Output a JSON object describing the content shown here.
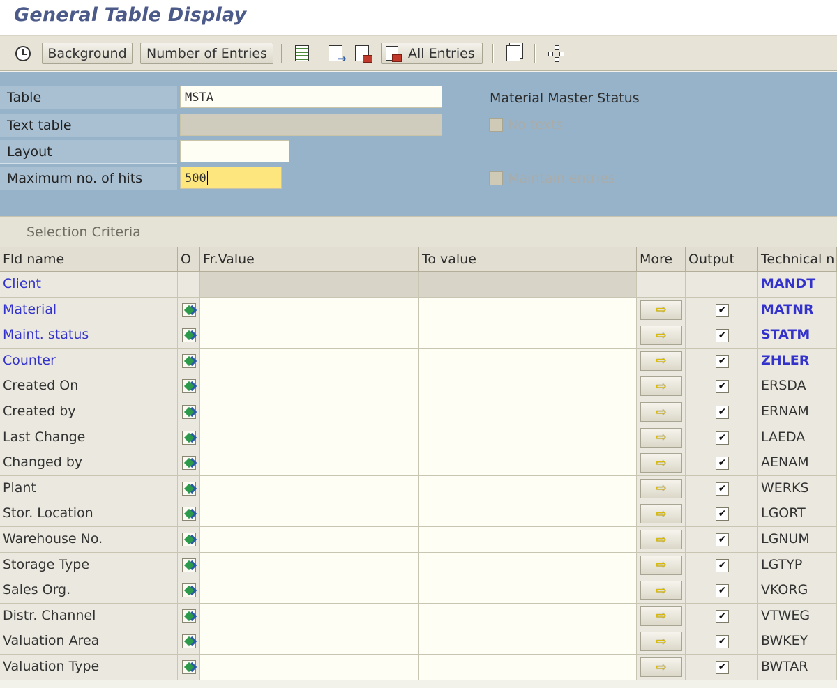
{
  "window": {
    "title": "General Table Display"
  },
  "toolbar": {
    "background_label": "Background",
    "number_of_entries_label": "Number of Entries",
    "all_entries_label": "All Entries"
  },
  "header": {
    "table_label": "Table",
    "table_value": "MSTA",
    "table_description": "Material Master Status",
    "text_table_label": "Text table",
    "text_table_value": "",
    "layout_label": "Layout",
    "layout_value": "",
    "max_hits_label": "Maximum no. of hits",
    "max_hits_value": "500",
    "no_texts_label": "No texts",
    "maintain_entries_label": "Maintain entries"
  },
  "selection": {
    "caption": "Selection Criteria",
    "columns": [
      "Fld name",
      "O",
      "Fr.Value",
      "To value",
      "More",
      "Output",
      "Technical n"
    ],
    "rows": [
      {
        "name": "Client",
        "tech": "MANDT",
        "key": true,
        "selectable": false
      },
      {
        "name": "Material",
        "tech": "MATNR",
        "key": true,
        "selectable": true
      },
      {
        "name": "Maint. status",
        "tech": "STATM",
        "key": true,
        "selectable": true
      },
      {
        "name": "Counter",
        "tech": "ZHLER",
        "key": true,
        "selectable": true
      },
      {
        "name": "Created On",
        "tech": "ERSDA",
        "key": false,
        "selectable": true
      },
      {
        "name": "Created by",
        "tech": "ERNAM",
        "key": false,
        "selectable": true
      },
      {
        "name": "Last Change",
        "tech": "LAEDA",
        "key": false,
        "selectable": true
      },
      {
        "name": "Changed by",
        "tech": "AENAM",
        "key": false,
        "selectable": true
      },
      {
        "name": "Plant",
        "tech": "WERKS",
        "key": false,
        "selectable": true
      },
      {
        "name": "Stor. Location",
        "tech": "LGORT",
        "key": false,
        "selectable": true
      },
      {
        "name": "Warehouse No.",
        "tech": "LGNUM",
        "key": false,
        "selectable": true
      },
      {
        "name": "Storage Type",
        "tech": "LGTYP",
        "key": false,
        "selectable": true
      },
      {
        "name": "Sales Org.",
        "tech": "VKORG",
        "key": false,
        "selectable": true
      },
      {
        "name": "Distr. Channel",
        "tech": "VTWEG",
        "key": false,
        "selectable": true
      },
      {
        "name": "Valuation Area",
        "tech": "BWKEY",
        "key": false,
        "selectable": true
      },
      {
        "name": "Valuation Type",
        "tech": "BWTAR",
        "key": false,
        "selectable": true
      }
    ]
  },
  "icons": {
    "execute": "clock-icon",
    "more": "arrow-right-icon",
    "option": "selection-option-icon"
  },
  "colors": {
    "key_field": "#3333cc",
    "header_bg": "#97b3c9",
    "title": "#4c5a8a"
  }
}
